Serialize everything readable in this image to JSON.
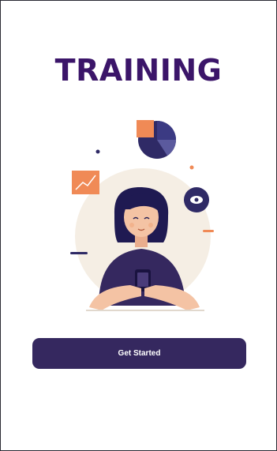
{
  "page": {
    "title": "TRAINING"
  },
  "illustration": {
    "subject": "woman-with-phone",
    "icons": [
      "pie-chart-icon",
      "line-chart-icon",
      "eye-icon"
    ]
  },
  "actions": {
    "get_started_label": "Get Started"
  },
  "colors": {
    "title": "#3b1569",
    "button": "#35285f",
    "accent_orange": "#f08a56",
    "navy": "#2f2a66",
    "skin": "#f4c3a4",
    "backdrop": "#f5eee4"
  }
}
